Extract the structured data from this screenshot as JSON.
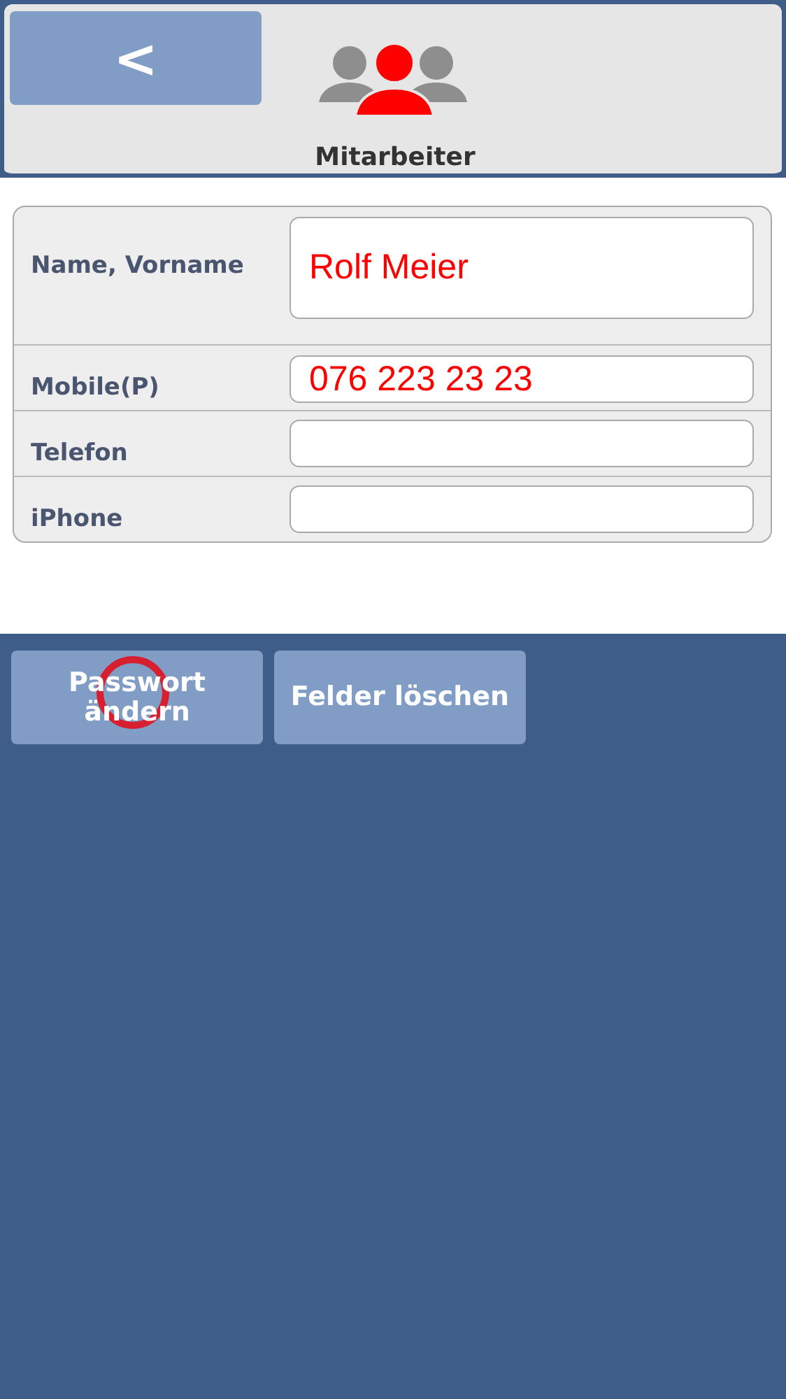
{
  "header": {
    "back_button": "<",
    "title": "Mitarbeiter"
  },
  "fields": [
    {
      "label": "Name, Vorname",
      "value": "Rolf Meier",
      "kind": "tall"
    },
    {
      "label": "Mobile(P)",
      "value": "076 223 23 23",
      "kind": "single"
    },
    {
      "label": "Telefon",
      "kind": "single"
    },
    {
      "label": "iPhone",
      "kind": "single"
    }
  ],
  "buttons": [
    {
      "label": "Passwort ändern",
      "touched": true
    },
    {
      "label": "Felder löschen",
      "touched": false
    }
  ]
}
